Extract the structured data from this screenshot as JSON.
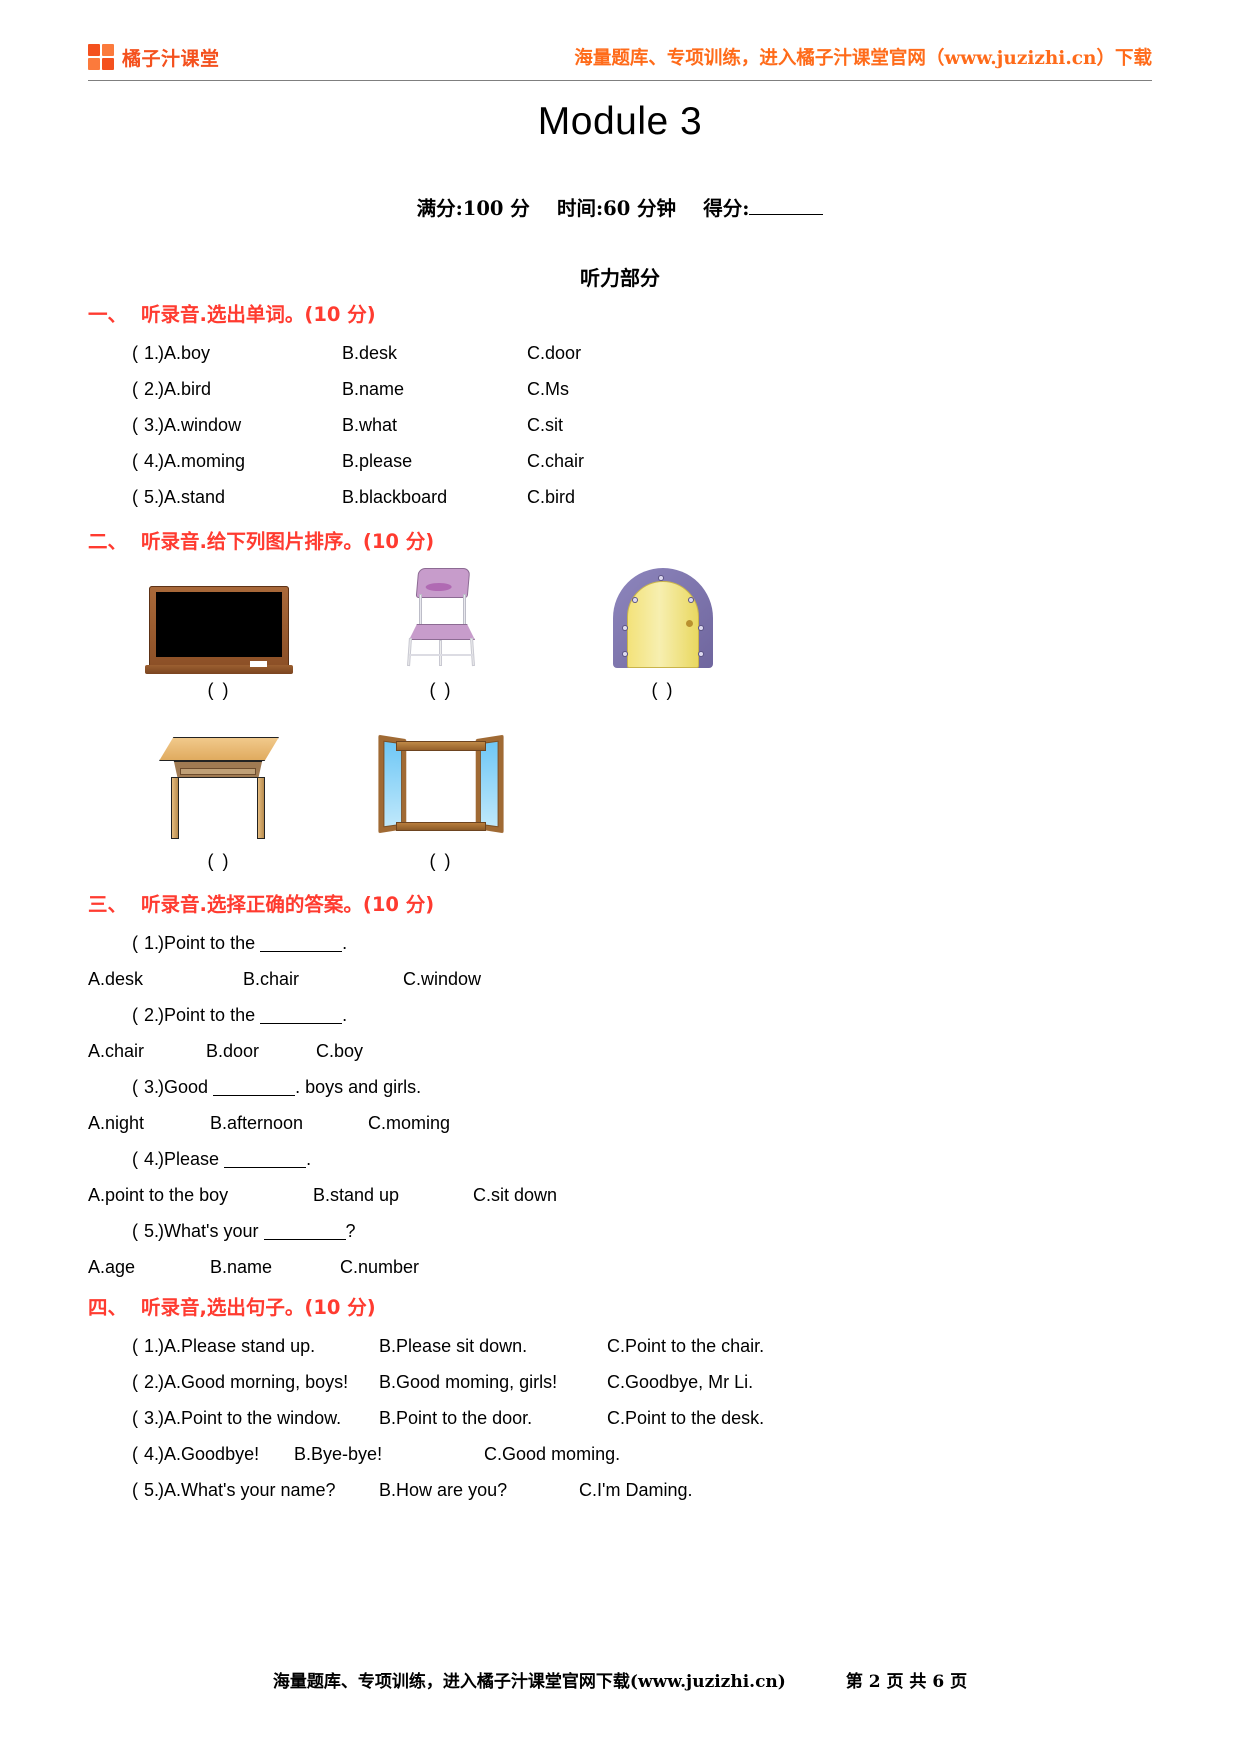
{
  "header": {
    "brand_name": "橘子汁课堂",
    "logo_icon": "orange-grid-logo-icon",
    "promo": "海量题库、专项训练，进入橘子汁课堂官网（www.juzizhi.cn）下载",
    "accent_color": "#f4511e",
    "promo_color": "#ff6b1a"
  },
  "title": "Module 3",
  "score_line": {
    "full_marks": "满分:100 分",
    "time": "时间:60 分钟",
    "score_label": "得分:"
  },
  "part_title": "听力部分",
  "section1": {
    "num": "一、",
    "heading": "听录音.选出单词。(10 分)",
    "items": [
      {
        "n": "1.",
        "a": "A.boy",
        "b": "B.desk",
        "c": "C.door"
      },
      {
        "n": "2.",
        "a": "A.bird",
        "b": "B.name",
        "c": "C.Ms"
      },
      {
        "n": "3.",
        "a": "A.window",
        "b": "B.what",
        "c": "C.sit"
      },
      {
        "n": "4.",
        "a": "A.moming",
        "b": "B.please",
        "c": "C.chair"
      },
      {
        "n": "5.",
        "a": "A.stand",
        "b": "B.blackboard",
        "c": "C.bird"
      }
    ]
  },
  "section2": {
    "num": "二、",
    "heading": "听录音.给下列图片排序。(10 分)",
    "pictures": [
      {
        "name": "blackboard-picture",
        "label": "(      )"
      },
      {
        "name": "chair-picture",
        "label": "(      )"
      },
      {
        "name": "door-picture",
        "label": "(      )"
      },
      {
        "name": "desk-picture",
        "label": "(      )"
      },
      {
        "name": "window-picture",
        "label": "(      )"
      }
    ]
  },
  "section3": {
    "num": "三、",
    "heading": "听录音.选择正确的答案。(10 分)",
    "items": [
      {
        "n": "1.",
        "stem_before": "Point to the",
        "stem_after": ".",
        "a": "A.desk",
        "b": "B.chair",
        "c": "C.window"
      },
      {
        "n": "2.",
        "stem_before": "Point to the",
        "stem_after": ".",
        "a": "A.chair",
        "b": "B.door",
        "c": "C.boy"
      },
      {
        "n": "3.",
        "stem_before": "Good",
        "stem_after": ". boys and girls.",
        "a": "A.night",
        "b": "B.afternoon",
        "c": "C.moming"
      },
      {
        "n": "4.",
        "stem_before": "Please",
        "stem_after": ".",
        "a": "A.point to the boy",
        "b": "B.stand up",
        "c": "C.sit down"
      },
      {
        "n": "5.",
        "stem_before": "What's your",
        "stem_after": "?",
        "a": "A.age",
        "b": "B.name",
        "c": "C.number"
      }
    ]
  },
  "section4": {
    "num": "四、",
    "heading": "听录音,选出句子。(10 分)",
    "items": [
      {
        "n": "1.",
        "a": "A.Please stand up.",
        "b": "B.Please sit down.",
        "c": "C.Point to the chair."
      },
      {
        "n": "2.",
        "a": "A.Good morning, boys!",
        "b": "B.Good moming, girls!",
        "c": "C.Goodbye, Mr Li."
      },
      {
        "n": "3.",
        "a": "A.Point to the window.",
        "b": "B.Point to the door.",
        "c": "C.Point to the desk."
      },
      {
        "n": "4.",
        "a": "A.Goodbye!",
        "b": "B.Bye-bye!",
        "c": "C.Good moming."
      },
      {
        "n": "5.",
        "a": "A.What's your name?",
        "b": "B.How are you?",
        "c": "C.I'm Daming."
      }
    ]
  },
  "footer": {
    "promo": "海量题库、专项训练，进入橘子汁课堂官网下载(www.juzizhi.cn)",
    "page": "第 2 页 共 6 页"
  }
}
